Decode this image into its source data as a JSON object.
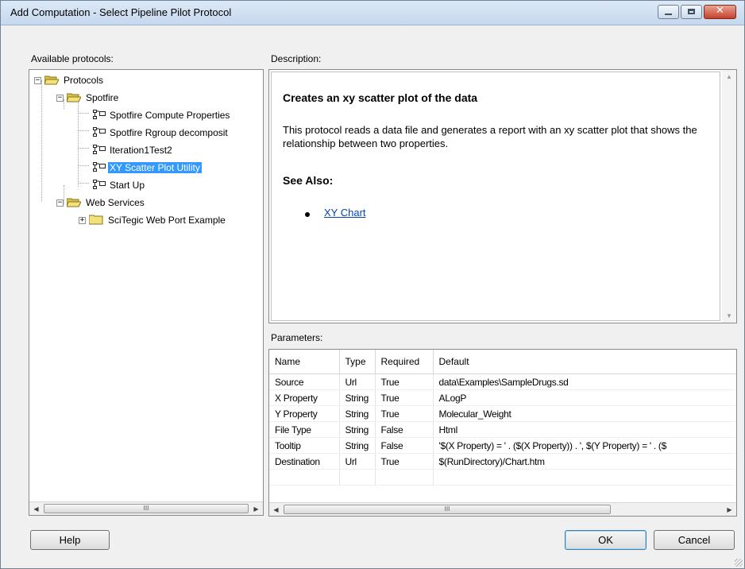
{
  "window": {
    "title": "Add Computation - Select Pipeline Pilot Protocol",
    "controls": {
      "minimize": "minimize-icon",
      "maximize": "maximize-icon",
      "close": "close-icon",
      "close_glyph": "✕"
    }
  },
  "labels": {
    "available": "Available protocols:",
    "description": "Description:",
    "parameters": "Parameters:"
  },
  "tree": {
    "root": "Protocols",
    "spotfire": "Spotfire",
    "items": [
      "Spotfire Compute Properties",
      "Spotfire Rgroup decomposit",
      "Iteration1Test2",
      "XY Scatter Plot Utility",
      "Start Up"
    ],
    "selected_index": 3,
    "web_services": "Web Services",
    "web_child": "SciTegic Web Port Example"
  },
  "description": {
    "heading": "Creates an xy scatter plot of the data",
    "body": "This protocol reads a data file and generates a report with an xy scatter plot that shows the relationship between two properties.",
    "see_also": "See Also:",
    "link": "XY Chart"
  },
  "params": {
    "headers": [
      "Name",
      "Type",
      "Required",
      "Default"
    ],
    "rows": [
      [
        "Source",
        "Url",
        "True",
        "data\\Examples\\SampleDrugs.sd"
      ],
      [
        "X Property",
        "String",
        "True",
        "ALogP"
      ],
      [
        "Y Property",
        "String",
        "True",
        "Molecular_Weight"
      ],
      [
        "File Type",
        "String",
        "False",
        "Html"
      ],
      [
        "Tooltip",
        "String",
        "False",
        "'$(X Property) = ' . ($(X Property))  . ', $(Y Property) = ' . ($"
      ],
      [
        "Destination",
        "Url",
        "True",
        "$(RunDirectory)/Chart.htm"
      ]
    ]
  },
  "scroll": {
    "left": "◀",
    "right": "▶",
    "up": "▲",
    "down": "▼",
    "grip": "III"
  },
  "buttons": {
    "help": "Help",
    "ok": "OK",
    "cancel": "Cancel"
  },
  "colors": {
    "selection": "#3399ff",
    "link": "#0645ad",
    "close_button": "#c6422b"
  }
}
